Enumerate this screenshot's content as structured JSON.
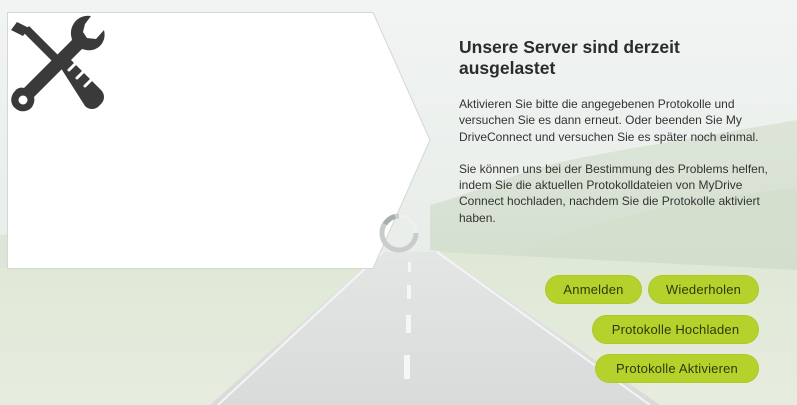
{
  "dialog": {
    "title": "Unsere Server sind derzeit ausgelastet",
    "paragraph_1": "Aktivieren Sie bitte die angegebenen Protokolle und versuchen Sie es dann erneut. Oder beenden Sie My DriveConnect und versuchen Sie es später noch einmal.",
    "paragraph_2": "Sie können uns bei der Bestimmung des Problems helfen, indem Sie die aktuellen Protokolldateien von MyDrive Connect hochladen, nachdem Sie die Protokolle aktiviert haben."
  },
  "buttons": {
    "login": "Anmelden",
    "retry": "Wiederholen",
    "upload_logs": "Protokolle Hochladen",
    "enable_logs": "Protokolle Aktivieren"
  },
  "icons": {
    "panel_icon": "tools-icon",
    "loading": "loading-spinner-icon"
  },
  "colors": {
    "button_bg": "#b5d22c",
    "button_text": "#2f3a0c",
    "icon": "#3a3a3a",
    "panel": "#ffffff"
  }
}
